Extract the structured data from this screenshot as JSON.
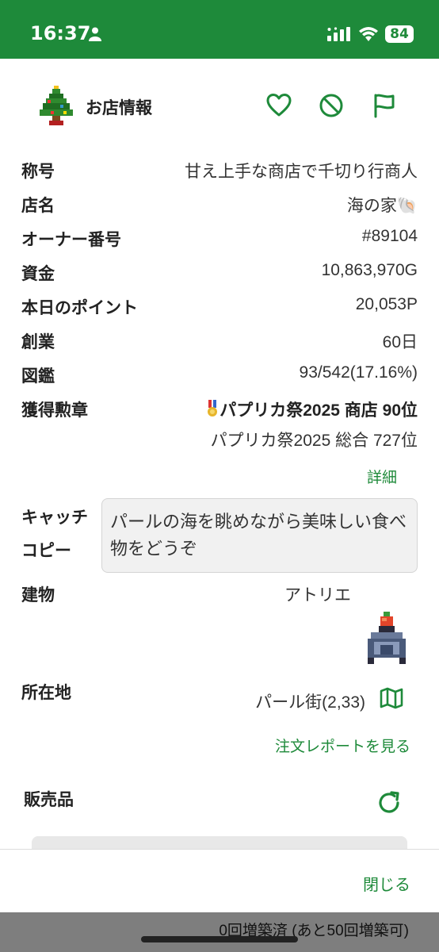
{
  "status_bar": {
    "time": "16:37",
    "battery": "84"
  },
  "header": {
    "title": "お店情報"
  },
  "fields": [
    {
      "label": "称号",
      "value": "甘え上手な商店で千切り行商人"
    },
    {
      "label": "店名",
      "value": "海の家🐚"
    },
    {
      "label": "オーナー番号",
      "value": "#89104"
    },
    {
      "label": "資金",
      "value": "10,863,970G"
    },
    {
      "label": "本日のポイント",
      "value": "20,053P"
    },
    {
      "label": "創業",
      "value": "60日"
    },
    {
      "label": "図鑑",
      "value": "93/542(17.16%)"
    }
  ],
  "medals": {
    "label": "獲得勲章",
    "primary": "パプリカ祭2025 商店 90位",
    "secondary": "パプリカ祭2025 総合 727位",
    "detail_link": "詳細"
  },
  "catchcopy": {
    "label_line1": "キャッチ",
    "label_line2": "コピー",
    "text": "パールの海を眺めながら美味しい食べ物をどうぞ"
  },
  "building": {
    "label": "建物",
    "value": "アトリエ"
  },
  "location": {
    "label": "所在地",
    "value": "パール街(2,33)"
  },
  "order_report_link": "注文レポートを見る",
  "products": {
    "label": "販売品"
  },
  "footer": {
    "close_label": "閉じる"
  },
  "background_text": "0回増築済 (あと50回増築可)",
  "colors": {
    "accent": "#1e8a3a",
    "status_bar": "#1e8a3a"
  },
  "icons": [
    "person-icon",
    "signal-icon",
    "wifi-icon",
    "tree-icon",
    "heart-icon",
    "block-icon",
    "flag-icon",
    "medal-icon",
    "building-icon",
    "map-icon",
    "refresh-icon"
  ]
}
